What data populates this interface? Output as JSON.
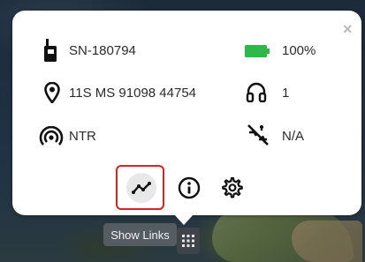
{
  "device": {
    "serial": "SN-180794",
    "battery": "100%",
    "battery_level": 1.0,
    "battery_color": "#2db84a",
    "location": "11S MS 91098 44754",
    "audio_count": "1",
    "network": "NTR",
    "link_status": "N/A"
  },
  "actions": {
    "links_icon": "trend-line-icon",
    "info_icon": "info-icon",
    "settings_icon": "gear-icon"
  },
  "popup": {
    "close_label": "×"
  },
  "tooltip": {
    "text": "Show Links"
  },
  "highlight_color": "#e02020"
}
